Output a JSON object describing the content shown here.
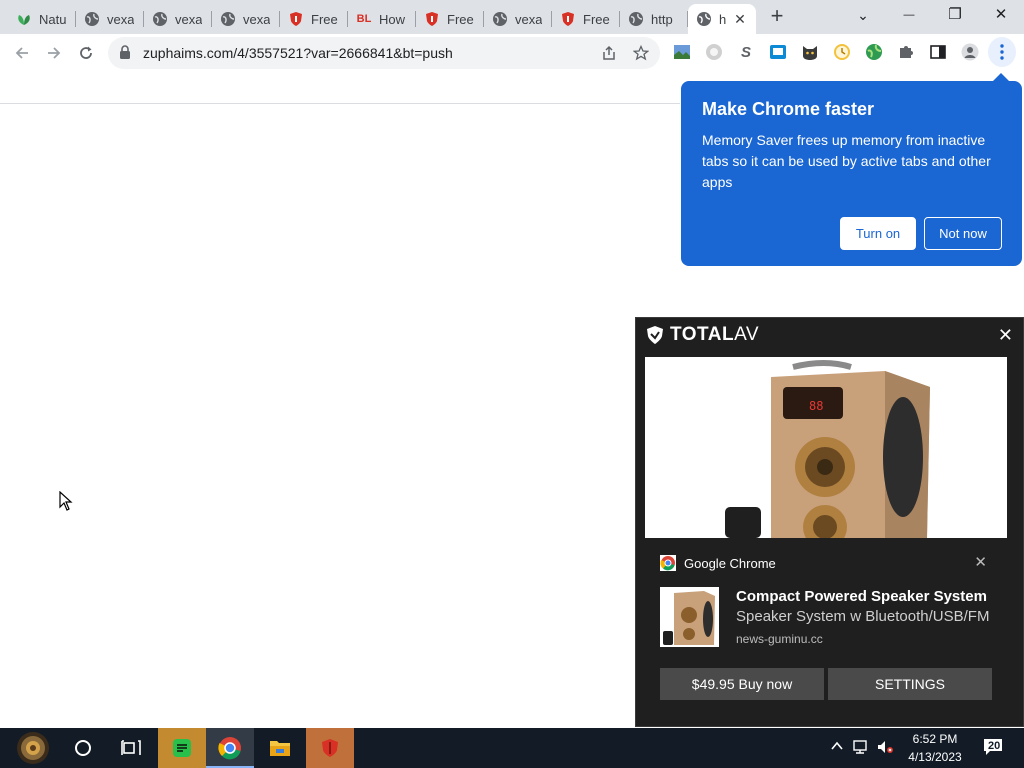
{
  "tabs": [
    {
      "title": "Natu",
      "icon": "plant-icon"
    },
    {
      "title": "vexa",
      "icon": "globe-icon"
    },
    {
      "title": "vexa",
      "icon": "globe-icon"
    },
    {
      "title": "vexa",
      "icon": "globe-icon"
    },
    {
      "title": "Free",
      "icon": "shield-red-icon"
    },
    {
      "title": "How",
      "icon": "bl-icon",
      "favicon_text": "BL"
    },
    {
      "title": "Free",
      "icon": "shield-red-icon"
    },
    {
      "title": "vexa",
      "icon": "globe-icon"
    },
    {
      "title": "Free",
      "icon": "shield-red-icon"
    },
    {
      "title": "http",
      "icon": "globe-icon"
    },
    {
      "title": "h",
      "icon": "globe-icon",
      "active": true
    }
  ],
  "window_controls": {
    "minimize": "—",
    "restore": "❐",
    "close": "✕",
    "tab_search": "⌄",
    "new_tab": "+"
  },
  "toolbar": {
    "url": "zuphaims.com/4/3557521?var=2666841&bt=push"
  },
  "chrome_bubble": {
    "title": "Make Chrome faster",
    "body": "Memory Saver frees up memory from inactive tabs so it can be used by active tabs and other apps",
    "turn_on_label": "Turn on",
    "not_now_label": "Not now",
    "color": "#1a66d2"
  },
  "notification": {
    "brand_total": "TOTAL",
    "brand_av": "AV",
    "app_name": "Google Chrome",
    "title": "Compact Powered Speaker System",
    "subtitle": "Speaker System w Bluetooth/USB/FM",
    "source": "news-guminu.cc",
    "buy_label": "$49.95 Buy now",
    "settings_label": "SETTINGS",
    "close": "✕"
  },
  "taskbar": {
    "time": "6:52 PM",
    "date": "4/13/2023",
    "notification_count": "20"
  }
}
